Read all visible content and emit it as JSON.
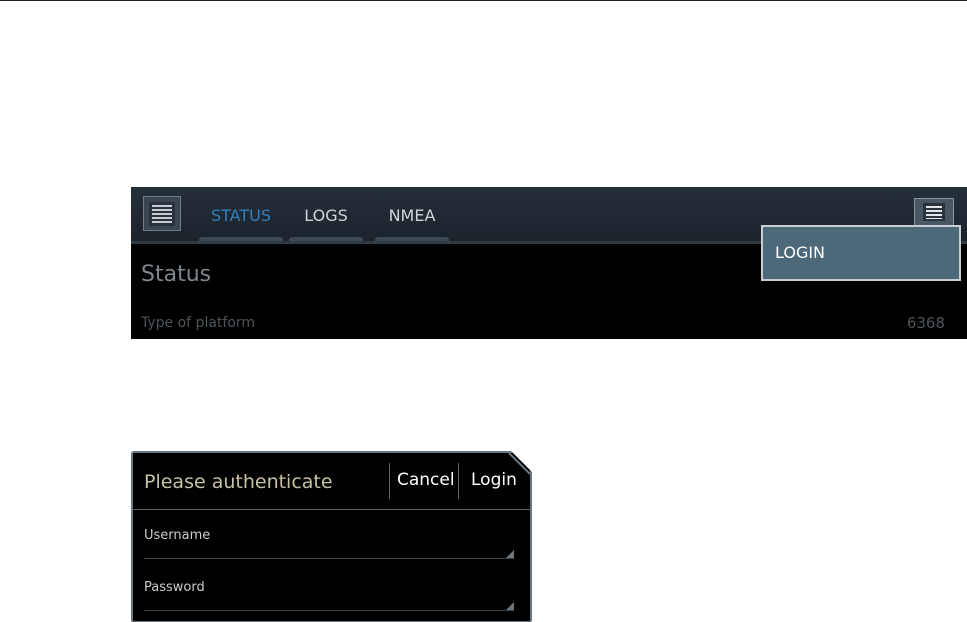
{
  "tabs": [
    {
      "label": "STATUS",
      "active": true
    },
    {
      "label": "LOGS",
      "active": false
    },
    {
      "label": "NMEA",
      "active": false
    }
  ],
  "status": {
    "title": "Status",
    "platform_label": "Type of platform",
    "platform_value": "6368"
  },
  "overflow_menu": {
    "items": [
      {
        "label": "LOGIN"
      }
    ]
  },
  "auth_dialog": {
    "title": "Please authenticate",
    "cancel_label": "Cancel",
    "login_label": "Login",
    "username_label": "Username",
    "password_label": "Password"
  },
  "icons": {
    "menu": "menu-list-icon",
    "overflow": "overflow-menu-icon"
  },
  "colors": {
    "active_tab": "#2e7fc0",
    "menu_highlight": "#4d6878",
    "dialog_title": "#c8c0a4"
  }
}
